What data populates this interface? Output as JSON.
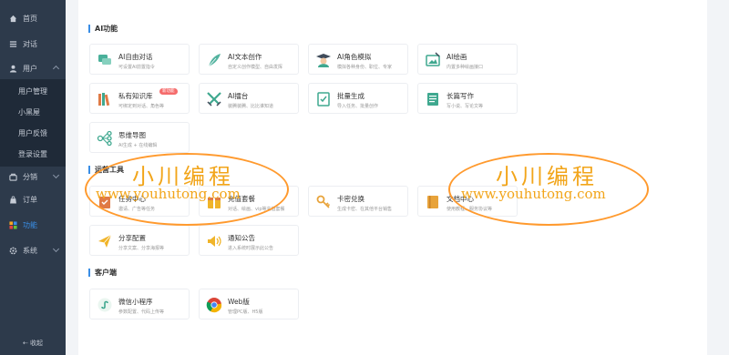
{
  "sidebar": {
    "items": [
      {
        "label": "首页",
        "icon": "home-icon"
      },
      {
        "label": "对话",
        "icon": "list-icon"
      },
      {
        "label": "用户",
        "icon": "user-icon"
      },
      {
        "label": "分销",
        "icon": "share-icon"
      },
      {
        "label": "订单",
        "icon": "bag-icon"
      },
      {
        "label": "功能",
        "icon": "grid-icon"
      },
      {
        "label": "系统",
        "icon": "gear-icon"
      }
    ],
    "user_subitems": [
      "用户管理",
      "小黑屋",
      "用户反馈",
      "登录设置"
    ],
    "collapse_label": "⇠ 收起",
    "active_color": "#3a8ee6"
  },
  "sections": [
    {
      "title": "AI功能",
      "cards": [
        {
          "title": "AI自由对话",
          "desc": "可设置AI前置指令",
          "icon": "chat-icon"
        },
        {
          "title": "AI文本创作",
          "desc": "自定义创作模型、自由发挥",
          "icon": "feather-icon"
        },
        {
          "title": "AI角色模拟",
          "desc": "模拟各种身份、职位、专家",
          "icon": "graduate-icon"
        },
        {
          "title": "AI绘画",
          "desc": "内置多种绘画接口",
          "icon": "paint-icon"
        },
        {
          "title": "私有知识库",
          "desc": "可绑定到对话、角色等",
          "icon": "books-icon",
          "badge": "新功能"
        },
        {
          "title": "AI擂台",
          "desc": "装腾装腾、比比谁知道",
          "icon": "swords-icon"
        },
        {
          "title": "批量生成",
          "desc": "导入任务、批量创作",
          "icon": "check-doc-icon"
        },
        {
          "title": "长篇写作",
          "desc": "写小说、写论文等",
          "icon": "doc-list-icon"
        },
        {
          "title": "思维导图",
          "desc": "AI生成 + 在线编辑",
          "icon": "mindmap-icon"
        }
      ]
    },
    {
      "title": "运营工具",
      "cards": [
        {
          "title": "任务中心",
          "desc": "邀请、广告等任务",
          "icon": "task-icon"
        },
        {
          "title": "充值套餐",
          "desc": "对话、绘画、vip等充值套餐",
          "icon": "package-icon"
        },
        {
          "title": "卡密兑换",
          "desc": "生成卡密、在其他平台销售",
          "icon": "key-icon"
        },
        {
          "title": "文档中心",
          "desc": "使用教程、服务协议等",
          "icon": "book-icon"
        },
        {
          "title": "分享配置",
          "desc": "分享文案、分享海报等",
          "icon": "send-icon"
        },
        {
          "title": "通知公告",
          "desc": "进入系统时展示此公告",
          "icon": "speaker-icon"
        }
      ]
    },
    {
      "title": "客户端",
      "cards": [
        {
          "title": "微信小程序",
          "desc": "参数配置、代码上传等",
          "icon": "miniprogram-icon"
        },
        {
          "title": "Web版",
          "desc": "管理PC版、H5版",
          "icon": "chrome-icon"
        }
      ]
    }
  ],
  "watermark": {
    "title": "小川编程",
    "url": "www.youhutong.com",
    "color": "#f2a51a"
  }
}
